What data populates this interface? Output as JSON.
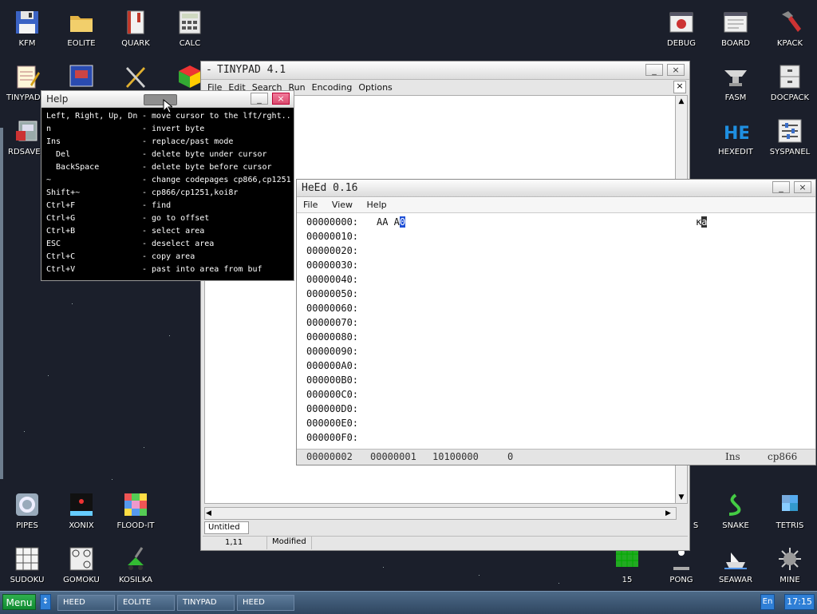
{
  "desktop_icons": [
    {
      "label": "KFM",
      "icon": "floppy-icon"
    },
    {
      "label": "EOLITE",
      "icon": "folder-icon"
    },
    {
      "label": "QUARK",
      "icon": "book-icon"
    },
    {
      "label": "CALC",
      "icon": "calculator-icon"
    },
    {
      "label": "TINYPAD",
      "icon": "notepad-icon"
    },
    {
      "label": "RDSAVE",
      "icon": "disk-save-icon"
    },
    {
      "label": "DEBUG",
      "icon": "bug-icon"
    },
    {
      "label": "BOARD",
      "icon": "board-icon"
    },
    {
      "label": "KPACK",
      "icon": "hammer-icon"
    },
    {
      "label": "FASM",
      "icon": "anvil-icon"
    },
    {
      "label": "DOCPACK",
      "icon": "cabinet-icon"
    },
    {
      "label": "HEXEDIT",
      "icon": "hexedit-icon"
    },
    {
      "label": "SYSPANEL",
      "icon": "sliders-icon"
    },
    {
      "label": "PIPES",
      "icon": "pipes-icon"
    },
    {
      "label": "XONIX",
      "icon": "xonix-icon"
    },
    {
      "label": "FLOOD-IT",
      "icon": "flood-icon"
    },
    {
      "label": "SNAKE",
      "icon": "snake-icon"
    },
    {
      "label": "TETRIS",
      "icon": "tetris-icon"
    },
    {
      "label": "SUDOKU",
      "icon": "sudoku-icon"
    },
    {
      "label": "GOMOKU",
      "icon": "gomoku-icon"
    },
    {
      "label": "KOSILKA",
      "icon": "mower-icon"
    },
    {
      "label": "15",
      "icon": "fifteen-icon"
    },
    {
      "label": "PONG",
      "icon": "pong-icon"
    },
    {
      "label": "SEAWAR",
      "icon": "seawar-icon"
    },
    {
      "label": "MINE",
      "icon": "mine-icon"
    },
    {
      "label": "S",
      "icon": "partial-icon"
    }
  ],
  "tinypad": {
    "title": "TINYPAD 4.1",
    "menu": [
      "File",
      "Edit",
      "Search",
      "Run",
      "Encoding",
      "Options"
    ],
    "tab": "Untitled",
    "status_pos": "1,11",
    "status_mod": "Modified"
  },
  "help": {
    "title": "Help",
    "rows": [
      {
        "key": "Left, Right, Up, Dn",
        "desc": "- move cursor to the lft/rght.."
      },
      {
        "key": "n",
        "desc": "- invert byte"
      },
      {
        "key": "Ins",
        "desc": "- replace/past mode"
      },
      {
        "key": "  Del",
        "desc": "- delete byte under cursor"
      },
      {
        "key": "  BackSpace",
        "desc": "- delete byte before cursor"
      },
      {
        "key": "~",
        "desc": "- change codepages cp866,cp1251"
      },
      {
        "key": "Shift+~",
        "desc": "- cp866/cp1251,koi8r"
      },
      {
        "key": "Ctrl+F",
        "desc": "- find"
      },
      {
        "key": "Ctrl+G",
        "desc": "- go to offset"
      },
      {
        "key": "Ctrl+B",
        "desc": "- select area"
      },
      {
        "key": "ESC",
        "desc": "- deselect area"
      },
      {
        "key": "Ctrl+C",
        "desc": "- copy area"
      },
      {
        "key": "Ctrl+V",
        "desc": "- past into area from buf"
      }
    ]
  },
  "heed": {
    "title": "HeEd 0.16",
    "menu": [
      "File",
      "View",
      "Help"
    ],
    "first_bytes": "AA A",
    "cursor_char": "0",
    "ascii_plain": "к",
    "ascii_sel": "a",
    "addresses": [
      "00000000:",
      "00000010:",
      "00000020:",
      "00000030:",
      "00000040:",
      "00000050:",
      "00000060:",
      "00000070:",
      "00000080:",
      "00000090:",
      "000000A0:",
      "000000B0:",
      "000000C0:",
      "000000D0:",
      "000000E0:",
      "000000F0:"
    ],
    "status": {
      "offset": "00000002",
      "size": "00000001",
      "bits": "10100000",
      "value": "0",
      "mode": "Ins",
      "codepage": "cp866"
    }
  },
  "taskbar": {
    "menu": "Menu",
    "tasks": [
      "HEED",
      "EOLITE",
      "TINYPAD",
      "HEED"
    ],
    "lang": "En",
    "clock": "17:15"
  }
}
